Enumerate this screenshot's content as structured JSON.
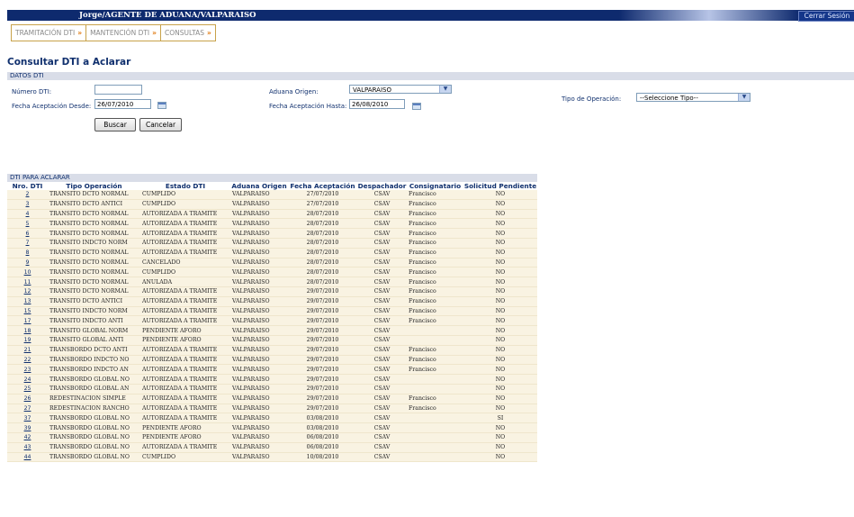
{
  "header": {
    "user_title": "Jorge/AGENTE DE ADUANA/VALPARAISO",
    "logout_label": "Cerrar Sesión"
  },
  "menu": [
    {
      "label": "TRAMITACIÓN DTI"
    },
    {
      "label": "MANTENCIÓN DTI"
    },
    {
      "label": "CONSULTAS"
    }
  ],
  "page_title": "Consultar DTI a Aclarar",
  "form": {
    "section_label": "DATOS DTI",
    "numero_dti_label": "Número DTI:",
    "numero_dti_value": "",
    "fecha_desde_label": "Fecha Aceptación Desde:",
    "fecha_desde_value": "26/07/2010",
    "aduana_origen_label": "Aduana Origen:",
    "aduana_origen_value": "VALPARAISO",
    "fecha_hasta_label": "Fecha Aceptación Hasta:",
    "fecha_hasta_value": "26/08/2010",
    "tipo_operacion_label": "Tipo de Operación:",
    "tipo_operacion_value": "--Seleccione Tipo--",
    "buscar_label": "Buscar",
    "cancelar_label": "Cancelar"
  },
  "grid": {
    "section_label": "DTI PARA ACLARAR",
    "columns": [
      "Nro. DTI",
      "Tipo Operación",
      "Estado DTI",
      "Aduana Origen",
      "Fecha Aceptación",
      "Despachador",
      "Consignatario",
      "Solicitud Pendiente"
    ],
    "rows": [
      [
        "2",
        "TRANSITO DCTO NORMAL",
        "CUMPLIDO",
        "VALPARAISO",
        "27/07/2010",
        "CSAV",
        "Francisco",
        "NO"
      ],
      [
        "3",
        "TRANSITO DCTO ANTICI",
        "CUMPLIDO",
        "VALPARAISO",
        "27/07/2010",
        "CSAV",
        "Francisco",
        "NO"
      ],
      [
        "4",
        "TRANSITO DCTO NORMAL",
        "AUTORIZADA A TRAMITE",
        "VALPARAISO",
        "28/07/2010",
        "CSAV",
        "Francisco",
        "NO"
      ],
      [
        "5",
        "TRANSITO DCTO NORMAL",
        "AUTORIZADA A TRAMITE",
        "VALPARAISO",
        "28/07/2010",
        "CSAV",
        "Francisco",
        "NO"
      ],
      [
        "6",
        "TRANSITO DCTO NORMAL",
        "AUTORIZADA A TRAMITE",
        "VALPARAISO",
        "28/07/2010",
        "CSAV",
        "Francisco",
        "NO"
      ],
      [
        "7",
        "TRANSITO INDCTO NORM",
        "AUTORIZADA A TRAMITE",
        "VALPARAISO",
        "28/07/2010",
        "CSAV",
        "Francisco",
        "NO"
      ],
      [
        "8",
        "TRANSITO DCTO NORMAL",
        "AUTORIZADA A TRAMITE",
        "VALPARAISO",
        "28/07/2010",
        "CSAV",
        "Francisco",
        "NO"
      ],
      [
        "9",
        "TRANSITO DCTO NORMAL",
        "CANCELADO",
        "VALPARAISO",
        "28/07/2010",
        "CSAV",
        "Francisco",
        "NO"
      ],
      [
        "10",
        "TRANSITO DCTO NORMAL",
        "CUMPLIDO",
        "VALPARAISO",
        "28/07/2010",
        "CSAV",
        "Francisco",
        "NO"
      ],
      [
        "11",
        "TRANSITO DCTO NORMAL",
        "ANULADA",
        "VALPARAISO",
        "28/07/2010",
        "CSAV",
        "Francisco",
        "NO"
      ],
      [
        "12",
        "TRANSITO DCTO NORMAL",
        "AUTORIZADA A TRAMITE",
        "VALPARAISO",
        "29/07/2010",
        "CSAV",
        "Francisco",
        "NO"
      ],
      [
        "13",
        "TRANSITO DCTO ANTICI",
        "AUTORIZADA A TRAMITE",
        "VALPARAISO",
        "29/07/2010",
        "CSAV",
        "Francisco",
        "NO"
      ],
      [
        "15",
        "TRANSITO INDCTO NORM",
        "AUTORIZADA A TRAMITE",
        "VALPARAISO",
        "29/07/2010",
        "CSAV",
        "Francisco",
        "NO"
      ],
      [
        "17",
        "TRANSITO INDCTO ANTI",
        "AUTORIZADA A TRAMITE",
        "VALPARAISO",
        "29/07/2010",
        "CSAV",
        "Francisco",
        "NO"
      ],
      [
        "18",
        "TRANSITO GLOBAL NORM",
        "PENDIENTE AFORO",
        "VALPARAISO",
        "29/07/2010",
        "CSAV",
        "",
        "NO"
      ],
      [
        "19",
        "TRANSITO GLOBAL ANTI",
        "PENDIENTE AFORO",
        "VALPARAISO",
        "29/07/2010",
        "CSAV",
        "",
        "NO"
      ],
      [
        "21",
        "TRANSBORDO DCTO ANTI",
        "AUTORIZADA A TRAMITE",
        "VALPARAISO",
        "29/07/2010",
        "CSAV",
        "Francisco",
        "NO"
      ],
      [
        "22",
        "TRANSBORDO INDCTO NO",
        "AUTORIZADA A TRAMITE",
        "VALPARAISO",
        "29/07/2010",
        "CSAV",
        "Francisco",
        "NO"
      ],
      [
        "23",
        "TRANSBORDO INDCTO AN",
        "AUTORIZADA A TRAMITE",
        "VALPARAISO",
        "29/07/2010",
        "CSAV",
        "Francisco",
        "NO"
      ],
      [
        "24",
        "TRANSBORDO GLOBAL NO",
        "AUTORIZADA A TRAMITE",
        "VALPARAISO",
        "29/07/2010",
        "CSAV",
        "",
        "NO"
      ],
      [
        "25",
        "TRANSBORDO GLOBAL AN",
        "AUTORIZADA A TRAMITE",
        "VALPARAISO",
        "29/07/2010",
        "CSAV",
        "",
        "NO"
      ],
      [
        "26",
        "REDESTINACION SIMPLE",
        "AUTORIZADA A TRAMITE",
        "VALPARAISO",
        "29/07/2010",
        "CSAV",
        "Francisco",
        "NO"
      ],
      [
        "27",
        "REDESTINACION RANCHO",
        "AUTORIZADA A TRAMITE",
        "VALPARAISO",
        "29/07/2010",
        "CSAV",
        "Francisco",
        "NO"
      ],
      [
        "37",
        "TRANSBORDO GLOBAL NO",
        "AUTORIZADA A TRAMITE",
        "VALPARAISO",
        "03/08/2010",
        "CSAV",
        "",
        "SI"
      ],
      [
        "39",
        "TRANSBORDO GLOBAL NO",
        "PENDIENTE AFORO",
        "VALPARAISO",
        "03/08/2010",
        "CSAV",
        "",
        "NO"
      ],
      [
        "42",
        "TRANSBORDO GLOBAL NO",
        "PENDIENTE AFORO",
        "VALPARAISO",
        "06/08/2010",
        "CSAV",
        "",
        "NO"
      ],
      [
        "43",
        "TRANSBORDO GLOBAL NO",
        "AUTORIZADA A TRAMITE",
        "VALPARAISO",
        "06/08/2010",
        "CSAV",
        "",
        "NO"
      ],
      [
        "44",
        "TRANSBORDO GLOBAL NO",
        "CUMPLIDO",
        "VALPARAISO",
        "10/08/2010",
        "CSAV",
        "",
        "NO"
      ]
    ]
  },
  "colors": {
    "header_bg": "#0e2a6e",
    "label": "#10306e",
    "row_bg": "#f9f3e2",
    "menu_border": "#c8a24a",
    "menu_chevron": "#e07a10"
  },
  "icons": {
    "menu_chevron": "double-chevron-down-icon",
    "calendar": "calendar-icon",
    "dropdown": "dropdown-arrow-icon"
  }
}
